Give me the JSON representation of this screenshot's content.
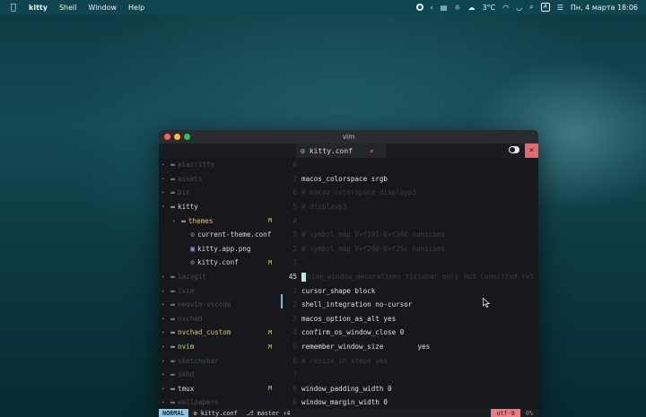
{
  "menubar": {
    "apple_icon": "apple-logo",
    "app_name": "kitty",
    "menus": [
      "Shell",
      "Window",
      "Help"
    ],
    "weather": "3°C",
    "datetime": "Пн, 4 марта  18:06",
    "input_indicator": "A"
  },
  "window": {
    "title": "vim",
    "tab": {
      "label": "kitty.conf",
      "close": "×"
    },
    "close_button": "×"
  },
  "tree": [
    {
      "name": "alacritty",
      "type": "dir",
      "expanded": false,
      "active": false,
      "flag": ""
    },
    {
      "name": "assets",
      "type": "dir",
      "expanded": false,
      "active": false,
      "flag": ""
    },
    {
      "name": "bin",
      "type": "dir",
      "expanded": false,
      "active": false,
      "flag": ""
    },
    {
      "name": "kitty",
      "type": "dir",
      "expanded": true,
      "active": true,
      "flag": ""
    },
    {
      "name": "themes",
      "type": "dir",
      "expanded": false,
      "active": true,
      "highlight": true,
      "flag": "M"
    },
    {
      "name": "current-theme.conf",
      "type": "file",
      "active": true,
      "flag": ""
    },
    {
      "name": "kitty.app.png",
      "type": "image",
      "active": true,
      "flag": ""
    },
    {
      "name": "kitty.conf",
      "type": "file",
      "active": true,
      "flag": "M"
    },
    {
      "name": "lazygit",
      "type": "dir",
      "expanded": false,
      "active": false,
      "flag": ""
    },
    {
      "name": "lvim",
      "type": "dir",
      "expanded": false,
      "active": false,
      "flag": ""
    },
    {
      "name": "neovim-vscode",
      "type": "dir",
      "expanded": false,
      "active": false,
      "flag": ""
    },
    {
      "name": "nvchad",
      "type": "dir",
      "expanded": false,
      "active": false,
      "flag": ""
    },
    {
      "name": "nvchad_custom",
      "type": "dir",
      "expanded": false,
      "active": true,
      "highlight": true,
      "flag": "M"
    },
    {
      "name": "nvim",
      "type": "dir",
      "expanded": false,
      "active": true,
      "highlight": true,
      "flag": "M"
    },
    {
      "name": "sketchybar",
      "type": "dir",
      "expanded": false,
      "active": false,
      "flag": ""
    },
    {
      "name": "skhd",
      "type": "dir",
      "expanded": false,
      "active": false,
      "flag": ""
    },
    {
      "name": "tmux",
      "type": "dir",
      "expanded": false,
      "active": true,
      "flag": "M"
    },
    {
      "name": "wallpapers",
      "type": "dir",
      "expanded": false,
      "active": false,
      "flag": ""
    }
  ],
  "gutter": [
    "8",
    "7",
    "6",
    "5",
    "4",
    "3",
    "2",
    "1",
    "45",
    "1",
    "2",
    "3",
    "4",
    "5",
    "6",
    "7",
    "8",
    "9"
  ],
  "code": [
    {
      "text": "",
      "comment": false
    },
    {
      "text": "macos_colorspace srgb",
      "comment": false
    },
    {
      "text": "# macos_colorspace displayp3",
      "comment": true
    },
    {
      "text": "# displayp3",
      "comment": true
    },
    {
      "text": "",
      "comment": false
    },
    {
      "text": "# symbol_map U+f101-U+f300 nonicons",
      "comment": true
    },
    {
      "text": "# symbol_map U+f200-U+f25c nonicons",
      "comment": true
    },
    {
      "text": "",
      "comment": false
    },
    {
      "text": "hide_window_decorations titlebar-only",
      "comment": true,
      "cursor": true,
      "blame": "Not Committed Yet"
    },
    {
      "text": "cursor_shape block",
      "comment": false
    },
    {
      "text": "shell_integration no-cursor",
      "comment": false
    },
    {
      "text": "macos_option_as_alt yes",
      "comment": false
    },
    {
      "text": "confirm_os_window_close 0",
      "comment": false
    },
    {
      "text": "remember_window_size",
      "comment": false,
      "gap": "yes"
    },
    {
      "text": "# resize_in_steps yes",
      "comment": true
    },
    {
      "text": "",
      "comment": false
    },
    {
      "text": "window_padding_width 0",
      "comment": false
    },
    {
      "text": "window_margin_width 0",
      "comment": false
    }
  ],
  "statusline": {
    "mode": "NORMAL",
    "file": "kitty.conf",
    "branch": "master ↑4",
    "encoding": "utf-8",
    "position": "0%"
  }
}
